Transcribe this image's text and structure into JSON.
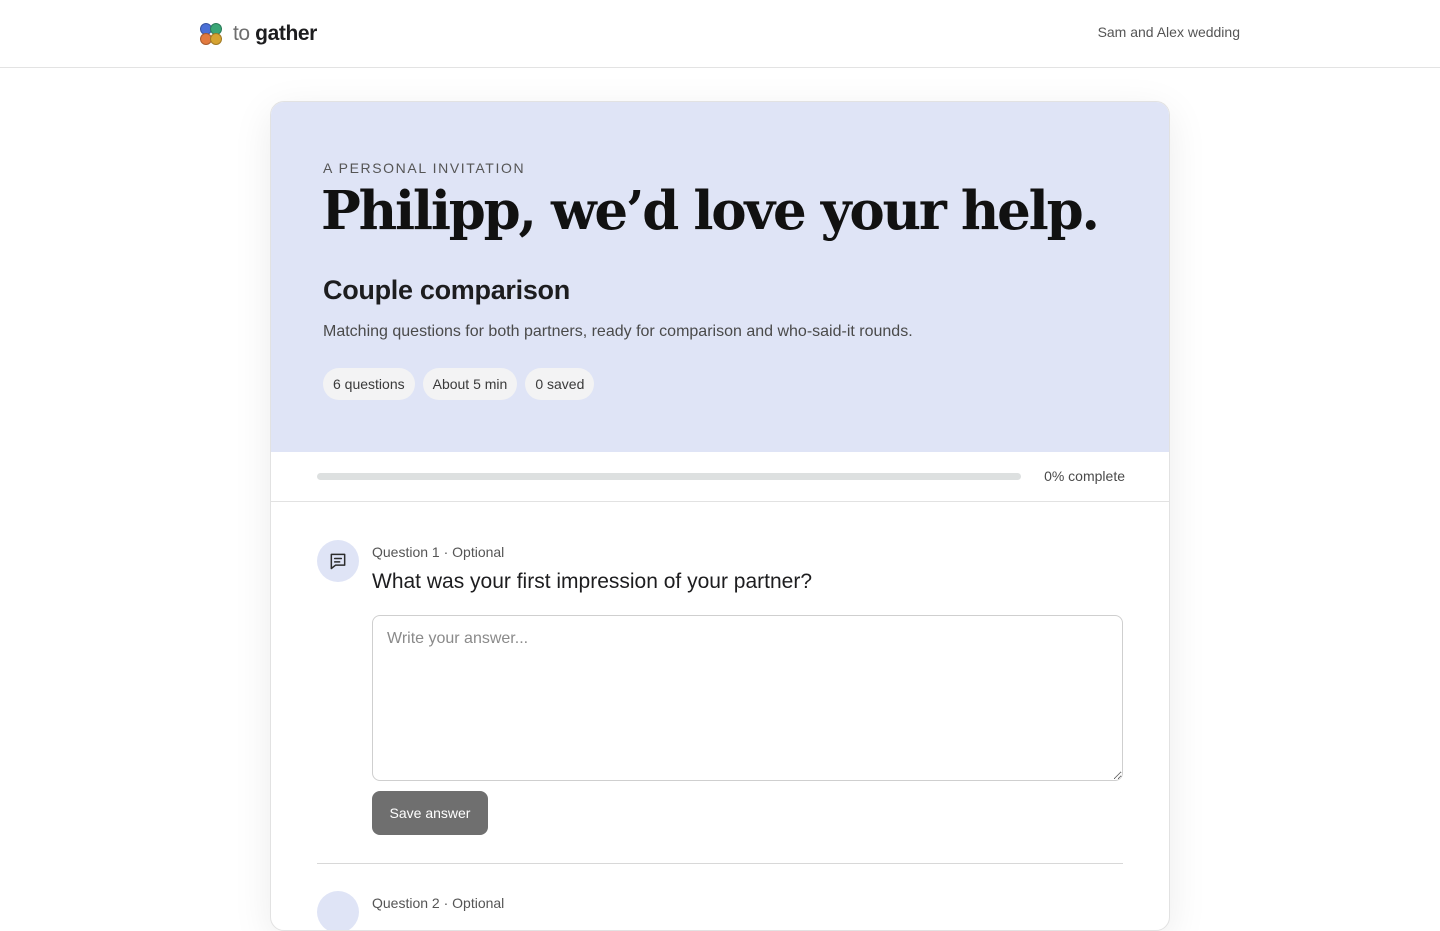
{
  "header": {
    "brand_light": "to",
    "brand_bold": "gather",
    "event_name": "Sam and Alex wedding"
  },
  "hero": {
    "eyebrow": "A PERSONAL INVITATION",
    "headline": "Philipp, we’d love your help.",
    "subtitle": "Couple comparison",
    "description": "Matching questions for both partners, ready for comparison and who-said-it rounds.",
    "chips": [
      "6 questions",
      "About 5 min",
      "0 saved"
    ],
    "background_color": "#dfe4f6"
  },
  "progress": {
    "value_percent": 0,
    "label": "0% complete"
  },
  "questions": [
    {
      "meta": "Question 1 · Optional",
      "title": "What was your first impression of your partner?",
      "answer_value": "",
      "answer_placeholder": "Write your answer...",
      "save_label": "Save answer",
      "icon": "message-square-text-icon"
    },
    {
      "meta": "Question 2 · Optional",
      "icon": "message-square-text-icon"
    }
  ]
}
